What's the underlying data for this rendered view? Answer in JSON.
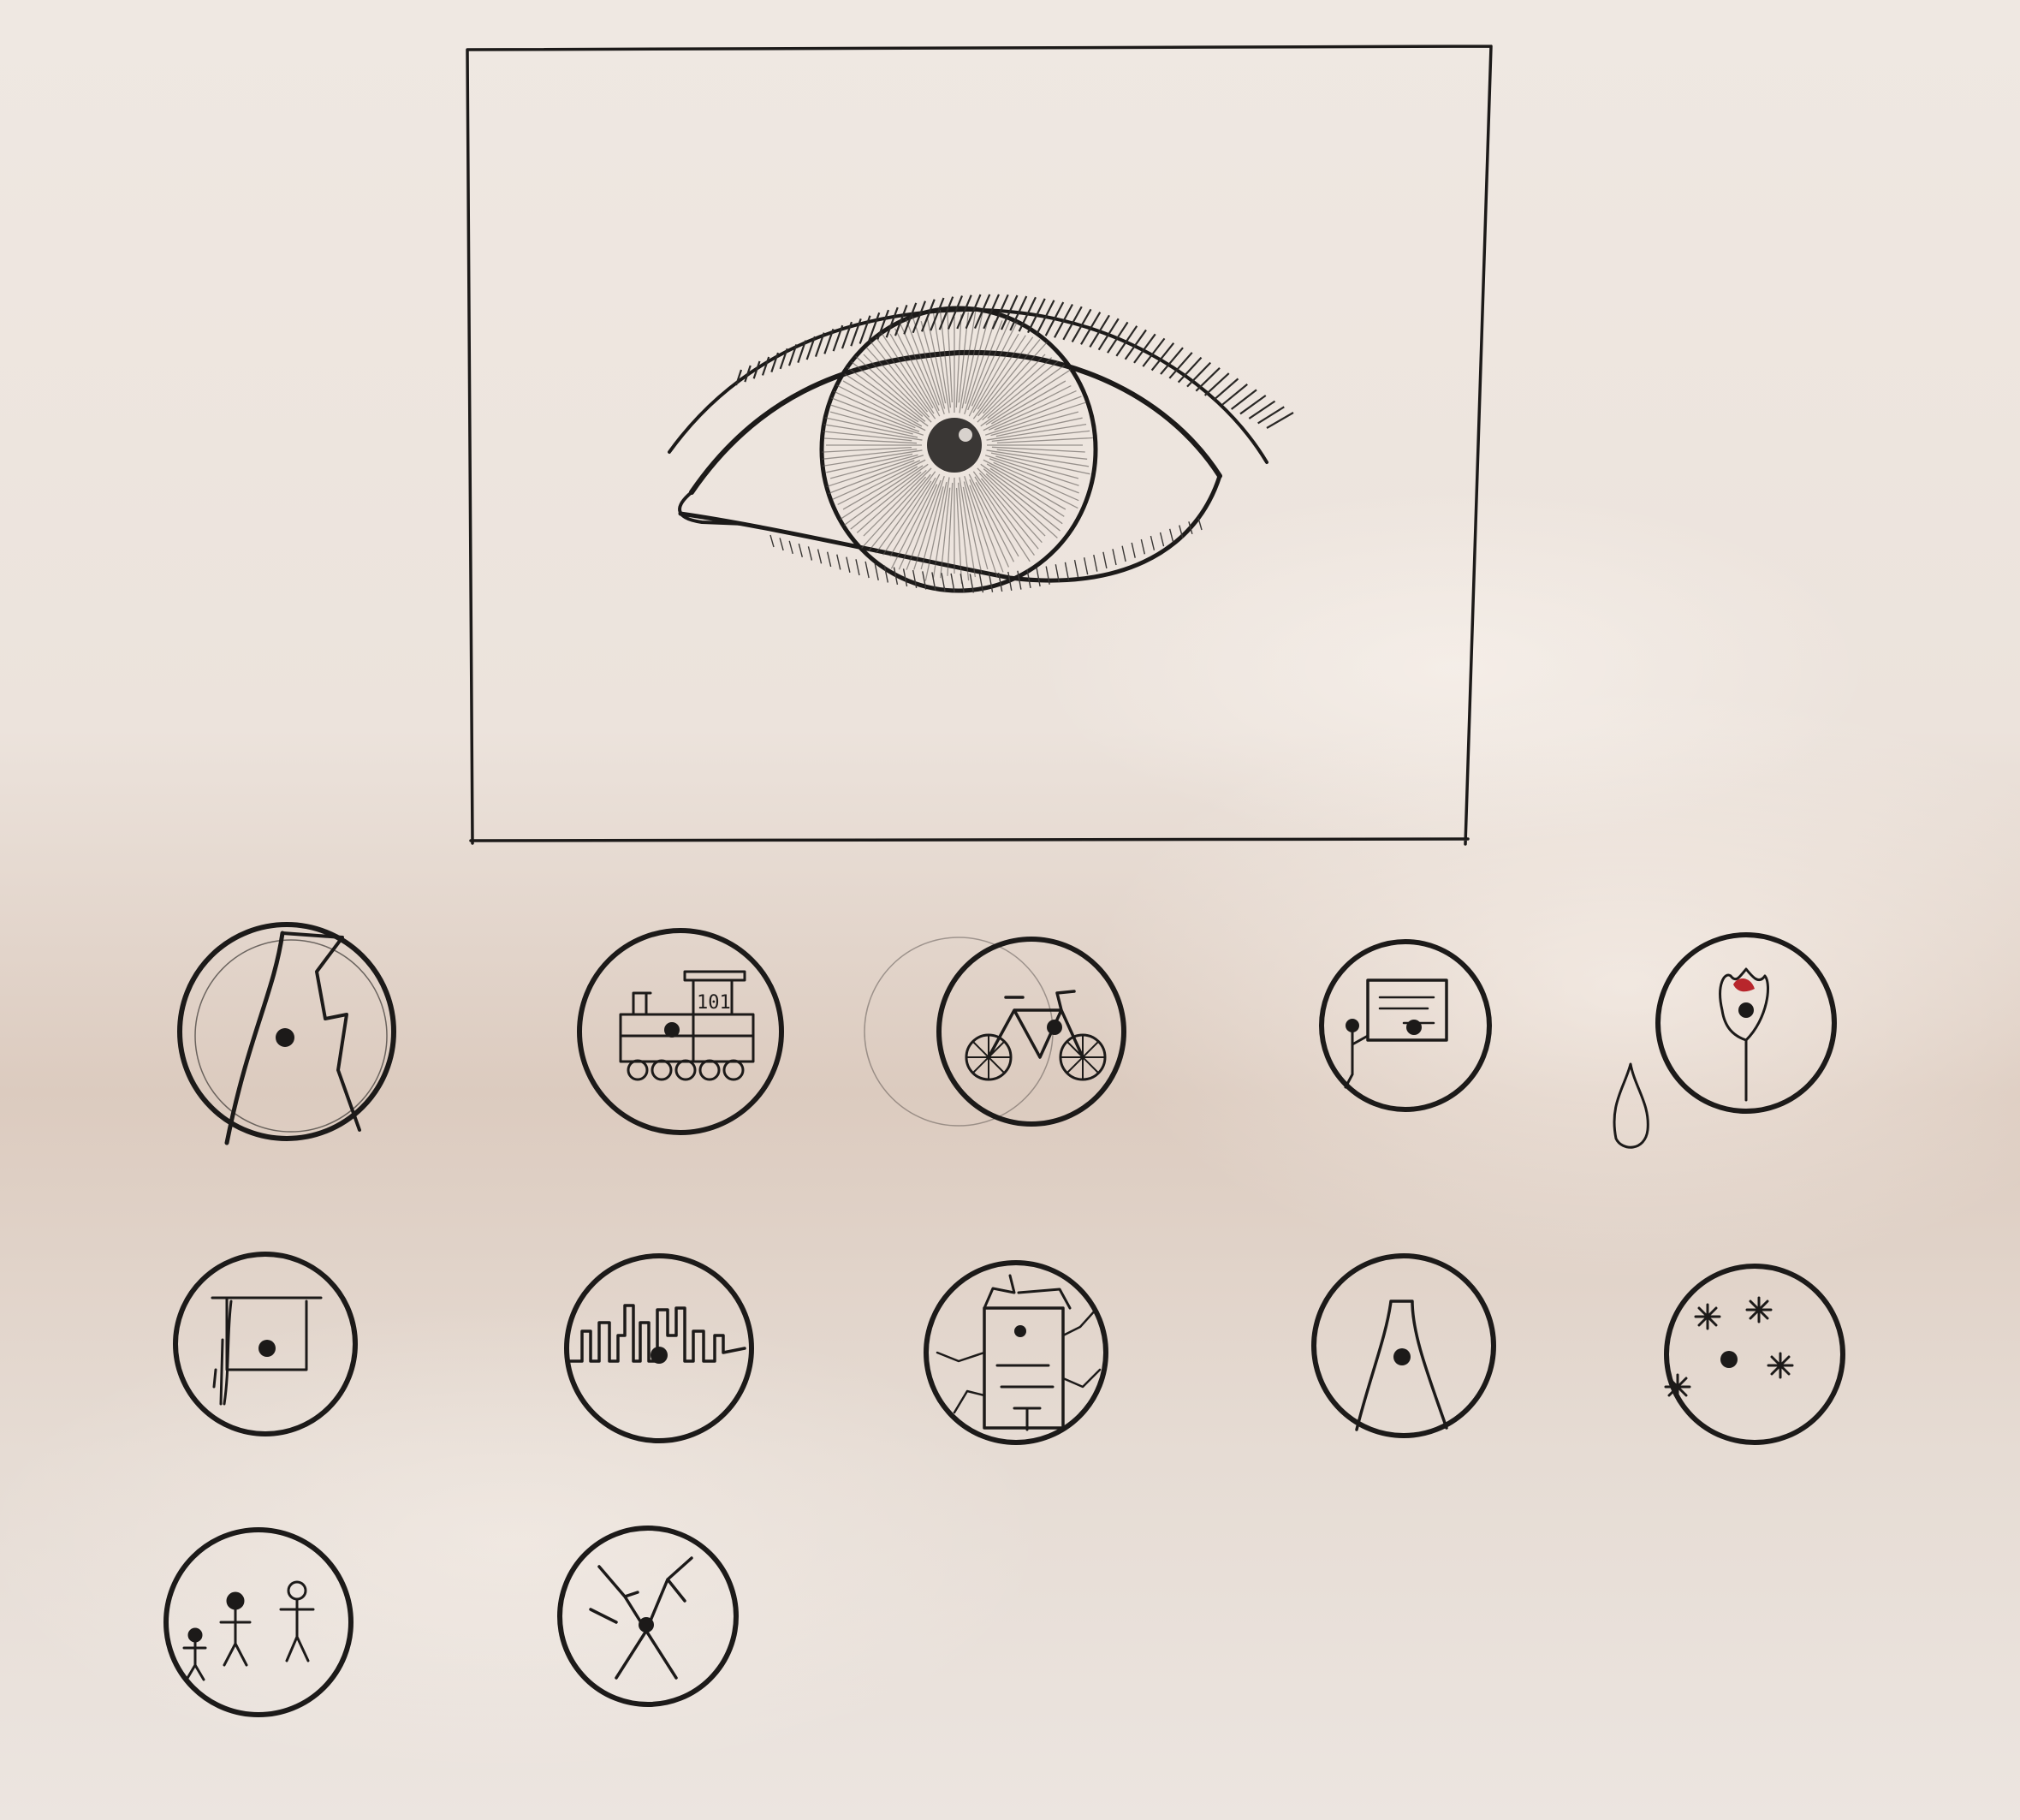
{
  "sketch": {
    "paper_color": "#ece3dc",
    "ink_color": "#1c1a19",
    "main_frame": {
      "subject": "eye-drawing"
    },
    "symbols": [
      {
        "row": 1,
        "icon": "cracked-eye-icon"
      },
      {
        "row": 1,
        "icon": "toy-train-icon"
      },
      {
        "row": 1,
        "icon": "bicycle-icon"
      },
      {
        "row": 1,
        "icon": "person-at-board-icon"
      },
      {
        "row": 1,
        "icon": "rose-teardrop-icon"
      },
      {
        "row": 2,
        "icon": "curtain-window-icon"
      },
      {
        "row": 2,
        "icon": "city-skyline-icon"
      },
      {
        "row": 2,
        "icon": "cracked-building-icon"
      },
      {
        "row": 2,
        "icon": "road-perspective-icon"
      },
      {
        "row": 2,
        "icon": "snowflake-pastel-icon"
      },
      {
        "row": 3,
        "icon": "family-stick-figures-icon"
      },
      {
        "row": 3,
        "icon": "shattered-eye-icon"
      }
    ]
  }
}
